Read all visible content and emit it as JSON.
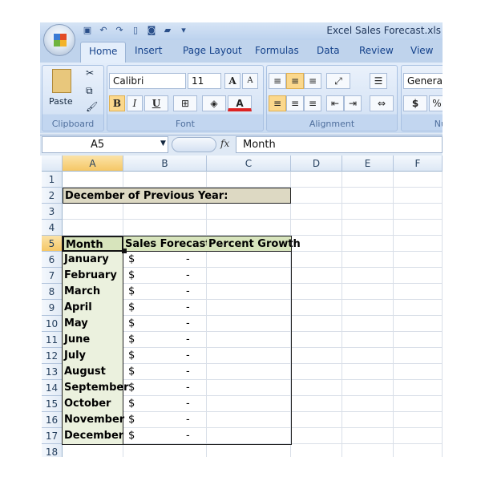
{
  "window": {
    "title": "Excel Sales Forecast.xls"
  },
  "tabs": [
    "Home",
    "Insert",
    "Page Layout",
    "Formulas",
    "Data",
    "Review",
    "View"
  ],
  "ribbon": {
    "clipboard": {
      "label": "Clipboard",
      "paste": "Paste"
    },
    "font": {
      "label": "Font",
      "name": "Calibri",
      "size": "11",
      "bold": "B",
      "italic": "I",
      "underline": "U",
      "grow": "A",
      "shrink": "A",
      "color": "A"
    },
    "alignment": {
      "label": "Alignment"
    },
    "number": {
      "label": "Nu",
      "format": "General",
      "currency": "$",
      "percent": "%"
    }
  },
  "formula_bar": {
    "name_box": "A5",
    "fx": "fx",
    "value": "Month"
  },
  "columns": [
    "A",
    "B",
    "C",
    "D",
    "E",
    "F"
  ],
  "rows": [
    "1",
    "2",
    "3",
    "4",
    "5",
    "6",
    "7",
    "8",
    "9",
    "10",
    "11",
    "12",
    "13",
    "14",
    "15",
    "16",
    "17",
    "18"
  ],
  "sheet": {
    "title": "December of Previous Year:",
    "headers": [
      "Month",
      "Sales Forecast",
      "Percent Growth"
    ],
    "currency": "$",
    "dash": "-",
    "months": [
      "January",
      "February",
      "March",
      "April",
      "May",
      "June",
      "July",
      "August",
      "September",
      "October",
      "November",
      "December"
    ]
  },
  "colors": {
    "header_fill": "#d7e4bc",
    "title_fill": "#ddd9c3",
    "month_fill": "#ebf1de"
  }
}
